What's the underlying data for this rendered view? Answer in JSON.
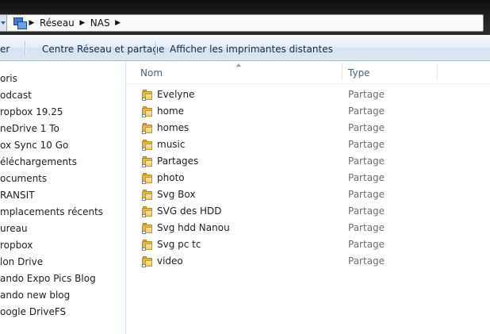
{
  "address_bar": {
    "breadcrumbs": [
      "Réseau",
      "NAS"
    ],
    "icon": "network-icon"
  },
  "toolbar": {
    "items": [
      "er",
      "Centre Réseau et partage",
      "Afficher les imprimantes distantes"
    ]
  },
  "navigation_pane": {
    "items": [
      "oris",
      "odcast",
      "ropbox 19.25",
      "neDrive 1 To",
      "ox Sync 10 Go",
      "éléchargements",
      "ocuments",
      "RANSIT",
      "mplacements récents",
      "ureau",
      "ropbox",
      "lon Drive",
      "ando Expo Pics Blog",
      "ando new blog",
      "oogle DriveFS"
    ]
  },
  "file_list": {
    "columns": {
      "name": "Nom",
      "type": "Type"
    },
    "rows": [
      {
        "name": "Evelyne",
        "type": "Partage"
      },
      {
        "name": "home",
        "type": "Partage"
      },
      {
        "name": "homes",
        "type": "Partage"
      },
      {
        "name": "music",
        "type": "Partage"
      },
      {
        "name": "Partages",
        "type": "Partage"
      },
      {
        "name": "photo",
        "type": "Partage"
      },
      {
        "name": "Svg Box",
        "type": "Partage"
      },
      {
        "name": "SVG des HDD",
        "type": "Partage"
      },
      {
        "name": "Svg hdd Nanou",
        "type": "Partage"
      },
      {
        "name": "Svg pc tc",
        "type": "Partage"
      },
      {
        "name": "video",
        "type": "Partage"
      }
    ],
    "row_icon": "shared-folder-icon"
  }
}
